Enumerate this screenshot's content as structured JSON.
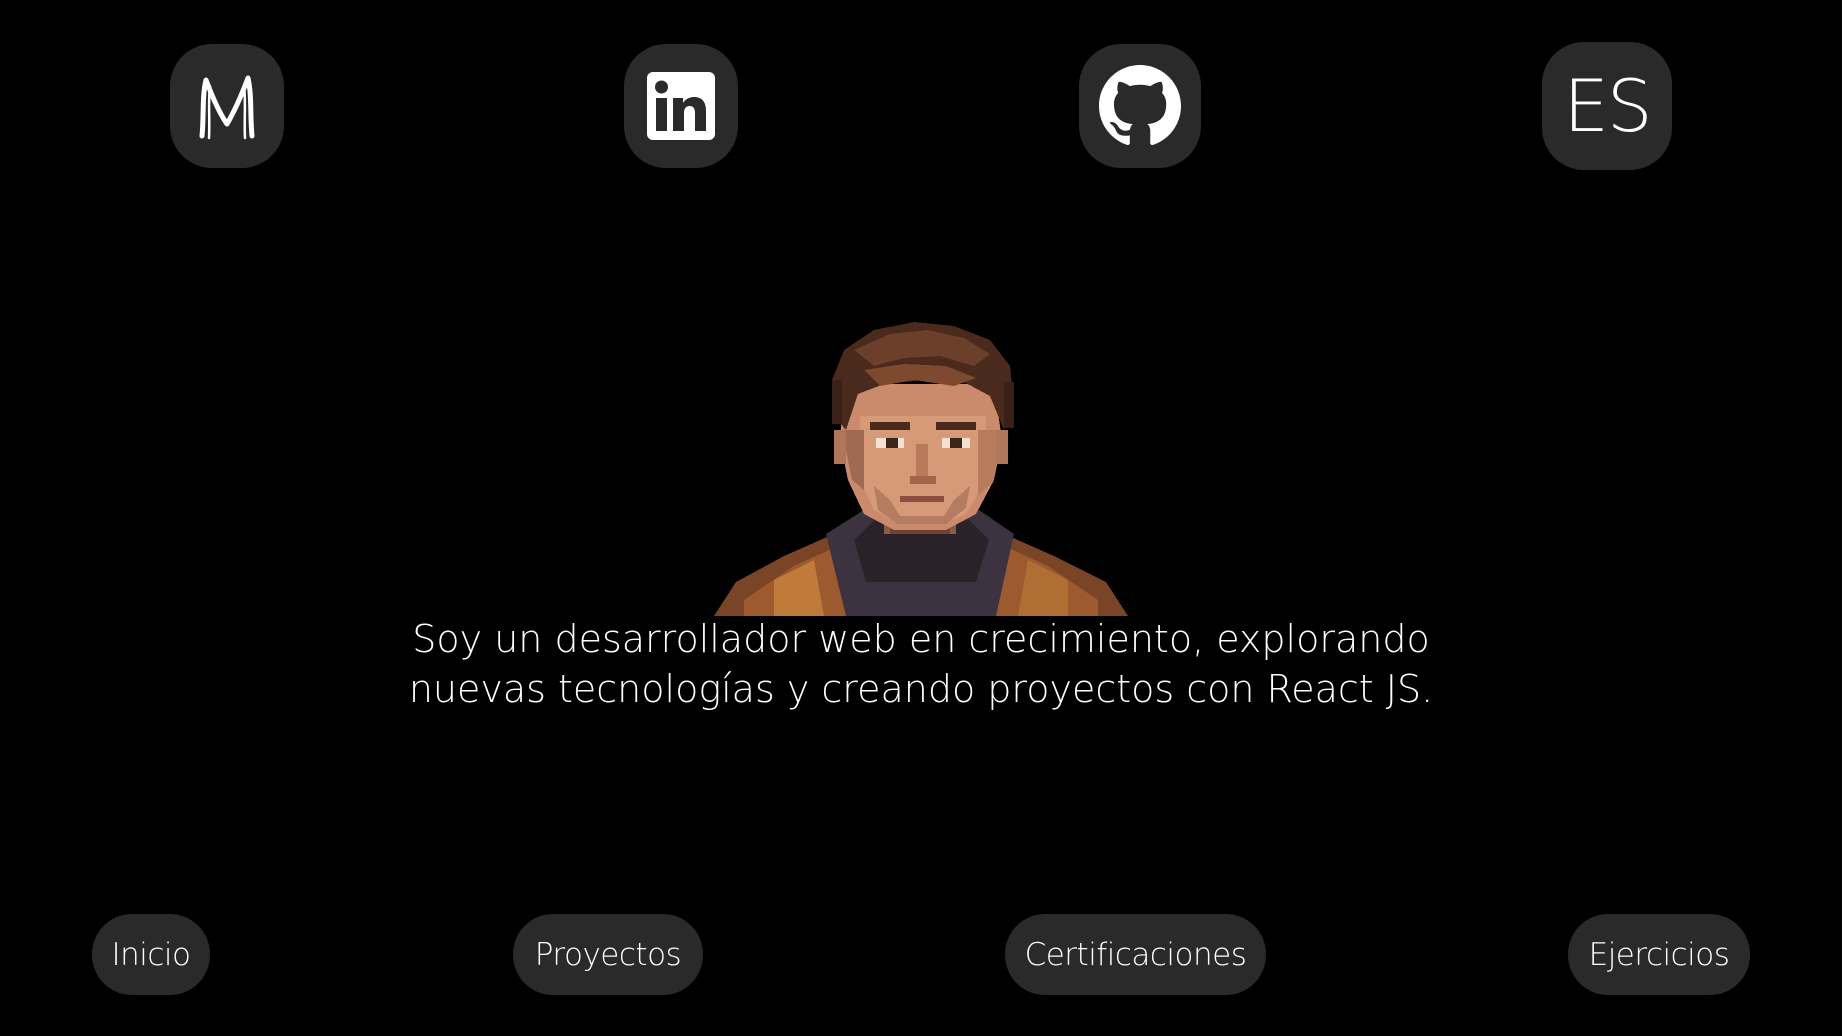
{
  "header": {
    "logo_icon": "m-monogram-icon",
    "linkedin_icon": "linkedin-icon",
    "github_icon": "github-icon",
    "language_label": "ES"
  },
  "hero": {
    "avatar_icon": "pixel-art-portrait",
    "bio_line1": "Soy un desarrollador web en crecimiento, explorando",
    "bio_line2": "nuevas tecnologías y creando proyectos con React JS."
  },
  "nav": {
    "items": [
      {
        "label": "Inicio"
      },
      {
        "label": "Proyectos"
      },
      {
        "label": "Certificaciones"
      },
      {
        "label": "Ejercicios"
      }
    ]
  },
  "colors": {
    "background": "#000000",
    "button_bg": "#2a2a2a",
    "text": "#ffffff"
  }
}
